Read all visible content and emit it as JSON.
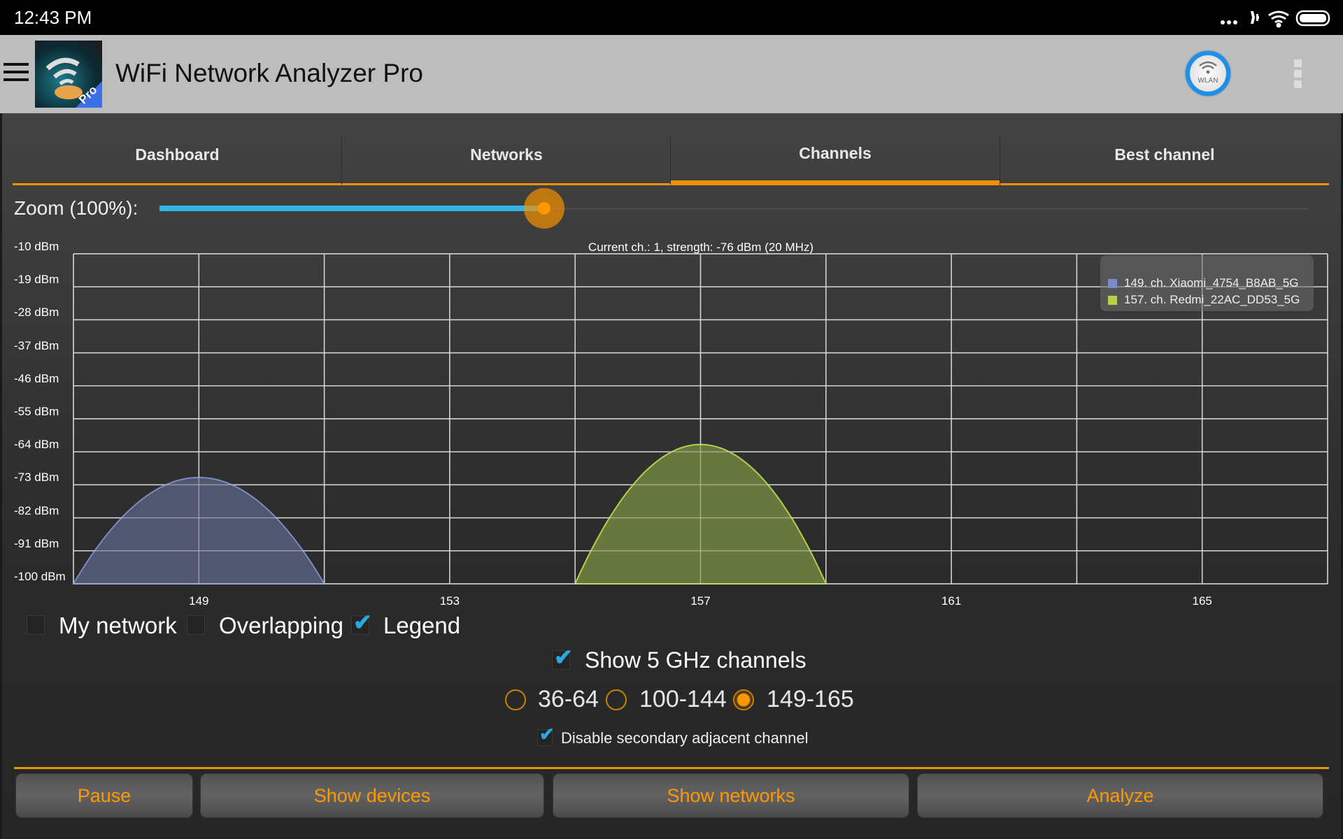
{
  "status_bar": {
    "time": "12:43 PM",
    "icons": [
      "more-dots-icon",
      "airplane-mode-icon",
      "wifi-signal-icon",
      "battery-icon"
    ]
  },
  "app_bar": {
    "menu_icon": "hamburger-menu-icon",
    "app_icon": "wifi-analyzer-pro-logo",
    "app_icon_badge": "Pro",
    "title": "WiFi Network Analyzer Pro",
    "wlan_button_label": "WLAN",
    "overflow_icon": "overflow-menu-icon"
  },
  "tabs": [
    {
      "label": "Dashboard",
      "active": false
    },
    {
      "label": "Networks",
      "active": false
    },
    {
      "label": "Channels",
      "active": true
    },
    {
      "label": "Best channel",
      "active": false
    }
  ],
  "zoom": {
    "label": "Zoom (100%):",
    "value_fraction": 0.335
  },
  "chart_data": {
    "type": "area",
    "title": "Current ch.: 1, strength: -76 dBm (20 MHz)",
    "xlabel": "",
    "ylabel": "",
    "x_range": [
      147,
      167
    ],
    "x_ticks": [
      149,
      153,
      157,
      161,
      165
    ],
    "x_gridlines_every": 2,
    "y_range": [
      -100,
      -10
    ],
    "y_ticks": [
      "-10 dBm",
      "-19 dBm",
      "-28 dBm",
      "-37 dBm",
      "-46 dBm",
      "-55 dBm",
      "-64 dBm",
      "-73 dBm",
      "-82 dBm",
      "-91 dBm",
      "-100 dBm"
    ],
    "y_tick_values": [
      -10,
      -19,
      -28,
      -37,
      -46,
      -55,
      -64,
      -73,
      -82,
      -91,
      -100
    ],
    "grid": true,
    "legend_position": "top-right",
    "series": [
      {
        "name": "149. ch. Xiaomi_4754_B8AB_5G",
        "channel": 149,
        "peak_dbm": -71,
        "width_channels": 4,
        "color": "#7b8bc4",
        "fill": "#535a74"
      },
      {
        "name": "157. ch. Redmi_22AC_DD53_5G",
        "channel": 157,
        "peak_dbm": -62,
        "width_channels": 4,
        "color": "#b5d14a",
        "fill": "#6b7b3f"
      }
    ]
  },
  "options": {
    "my_network": {
      "label": "My network",
      "checked": false
    },
    "overlapping": {
      "label": "Overlapping",
      "checked": false
    },
    "legend": {
      "label": "Legend",
      "checked": true
    },
    "show_5ghz": {
      "label": "Show 5 GHz channels",
      "checked": true
    },
    "bands": [
      {
        "label": "36-64",
        "selected": false
      },
      {
        "label": "100-144",
        "selected": false
      },
      {
        "label": "149-165",
        "selected": true
      }
    ],
    "disable_secondary": {
      "label": "Disable secondary adjacent channel",
      "checked": true
    }
  },
  "buttons": {
    "pause": "Pause",
    "show_devices": "Show devices",
    "show_networks": "Show networks",
    "analyze": "Analyze"
  },
  "colors": {
    "accent": "#f39200",
    "slider": "#34b4e4",
    "check": "#29a8e0"
  }
}
